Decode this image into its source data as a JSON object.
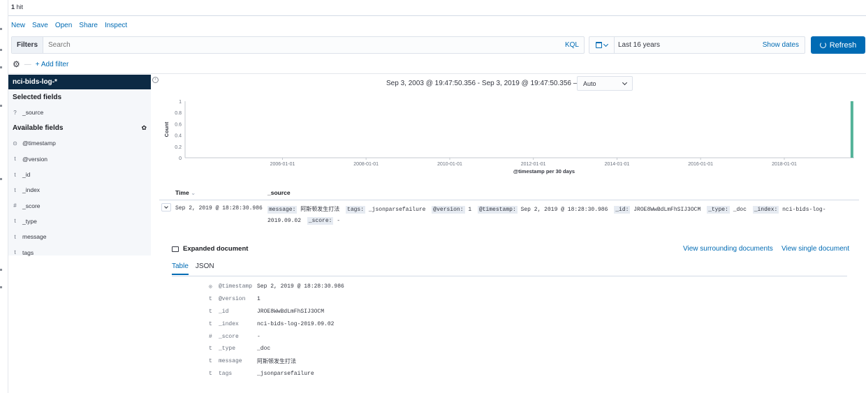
{
  "hits": {
    "count": "1",
    "label": "hit"
  },
  "menu": [
    "New",
    "Save",
    "Open",
    "Share",
    "Inspect"
  ],
  "query": {
    "filters_label": "Filters",
    "placeholder": "Search",
    "language": "KQL"
  },
  "date": {
    "range": "Last 16 years",
    "show_dates": "Show dates"
  },
  "refresh": {
    "label": "Refresh"
  },
  "filter_bar": {
    "add_filter": "+ Add filter"
  },
  "sidebar": {
    "index_pattern": "nci-bids-log-*",
    "selected_title": "Selected fields",
    "selected_fields": [
      {
        "type": "?",
        "name": "_source"
      }
    ],
    "available_title": "Available fields",
    "available_fields": [
      {
        "type": "clock",
        "name": "@timestamp"
      },
      {
        "type": "t",
        "name": "@version"
      },
      {
        "type": "t",
        "name": "_id"
      },
      {
        "type": "t",
        "name": "_index"
      },
      {
        "type": "#",
        "name": "_score"
      },
      {
        "type": "t",
        "name": "_type"
      },
      {
        "type": "t",
        "name": "message"
      },
      {
        "type": "t",
        "name": "tags"
      }
    ]
  },
  "histogram": {
    "time_range": "Sep 3, 2003 @ 19:47:50.356 - Sep 3, 2019 @ 19:47:50.356 —",
    "interval": "Auto"
  },
  "chart_data": {
    "type": "bar",
    "ylabel": "Count",
    "xlabel": "@timestamp per 30 days",
    "ylim": [
      0,
      1
    ],
    "y_ticks": [
      "0",
      "0.2",
      "0.4",
      "0.6",
      "0.8",
      "1"
    ],
    "x_ticks": [
      "2006-01-01",
      "2008-01-01",
      "2010-01-01",
      "2012-01-01",
      "2014-01-01",
      "2016-01-01",
      "2018-01-01"
    ],
    "x_range": [
      "2003-09-03",
      "2019-09-03"
    ],
    "bars": [
      {
        "x": "2019-08-15",
        "value": 1
      }
    ],
    "bar_color": "#54b399"
  },
  "table": {
    "col_time": "Time",
    "col_source": "_source",
    "row": {
      "time": "Sep 2, 2019 @ 18:28:30.986",
      "source": [
        {
          "k": "message:",
          "v": "阿斯顿发生打法"
        },
        {
          "k": "tags:",
          "v": "_jsonparsefailure"
        },
        {
          "k": "@version:",
          "v": "1"
        },
        {
          "k": "@timestamp:",
          "v": "Sep 2, 2019 @ 18:28:30.986"
        },
        {
          "k": "_id:",
          "v": "JROE8WwBdLmFhSIJ3OCM"
        },
        {
          "k": "_type:",
          "v": "_doc"
        },
        {
          "k": "_index:",
          "v": "nci-bids-log-2019.09.02"
        },
        {
          "k": "_score:",
          "v": "-"
        }
      ]
    }
  },
  "expanded": {
    "title": "Expanded document",
    "view_surrounding": "View surrounding documents",
    "view_single": "View single document",
    "tabs": [
      "Table",
      "JSON"
    ],
    "fields": [
      {
        "type": "clock",
        "key": "@timestamp",
        "value": "Sep 2, 2019 @ 18:28:30.986"
      },
      {
        "type": "t",
        "key": "@version",
        "value": "1"
      },
      {
        "type": "t",
        "key": "_id",
        "value": "JROE8WwBdLmFhSIJ3OCM"
      },
      {
        "type": "t",
        "key": "_index",
        "value": "nci-bids-log-2019.09.02"
      },
      {
        "type": "#",
        "key": "_score",
        "value": "-"
      },
      {
        "type": "t",
        "key": "_type",
        "value": "_doc"
      },
      {
        "type": "t",
        "key": "message",
        "value": "阿斯顿发生打法"
      },
      {
        "type": "t",
        "key": "tags",
        "value": "_jsonparsefailure"
      }
    ]
  }
}
